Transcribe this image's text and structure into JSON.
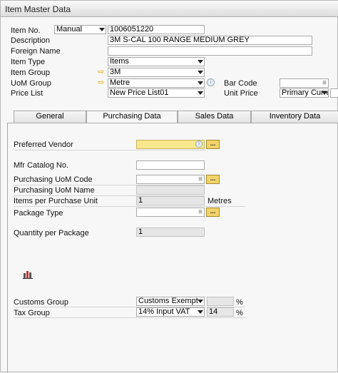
{
  "window": {
    "title": "Item Master Data"
  },
  "header": {
    "item_no": {
      "label": "Item No.",
      "series": "Manual",
      "value": "1006051220"
    },
    "description": {
      "label": "Description",
      "value": "3M S-CAL 100 RANGE MEDIUM GREY"
    },
    "foreign_name": {
      "label": "Foreign Name",
      "value": ""
    },
    "item_type": {
      "label": "Item Type",
      "value": "Items"
    },
    "item_group": {
      "label": "Item Group",
      "value": "3M"
    },
    "uom_group": {
      "label": "UoM Group",
      "value": "Metre"
    },
    "price_list": {
      "label": "Price List",
      "value": "New Price List01"
    },
    "bar_code": {
      "label": "Bar Code",
      "value": ""
    },
    "unit_price": {
      "label": "Unit Price",
      "currency": "Primary Curre"
    }
  },
  "tabs": [
    {
      "label": "General"
    },
    {
      "label": "Purchasing Data"
    },
    {
      "label": "Sales Data"
    },
    {
      "label": "Inventory Data"
    }
  ],
  "purchasing": {
    "preferred_vendor": {
      "label": "Preferred Vendor",
      "value": ""
    },
    "mfr_catalog_no": {
      "label": "Mfr Catalog No.",
      "value": ""
    },
    "purchasing_uom_code": {
      "label": "Purchasing UoM Code",
      "value": ""
    },
    "purchasing_uom_name": {
      "label": "Purchasing UoM Name",
      "value": ""
    },
    "items_per_purchase_unit": {
      "label": "Items per Purchase Unit",
      "value": "1",
      "unit": "Metres"
    },
    "package_type": {
      "label": "Package Type",
      "value": ""
    },
    "quantity_per_package": {
      "label": "Quantity per Package",
      "value": "1"
    },
    "customs_group": {
      "label": "Customs Group",
      "value": "Customs Exempt",
      "rate": "",
      "pct": "%"
    },
    "tax_group": {
      "label": "Tax Group",
      "value": "14% Input VAT",
      "rate": "14",
      "pct": "%"
    }
  },
  "icons": {
    "dots": "...",
    "link_arrow": "⇨",
    "list": "≡",
    "info": "i"
  }
}
